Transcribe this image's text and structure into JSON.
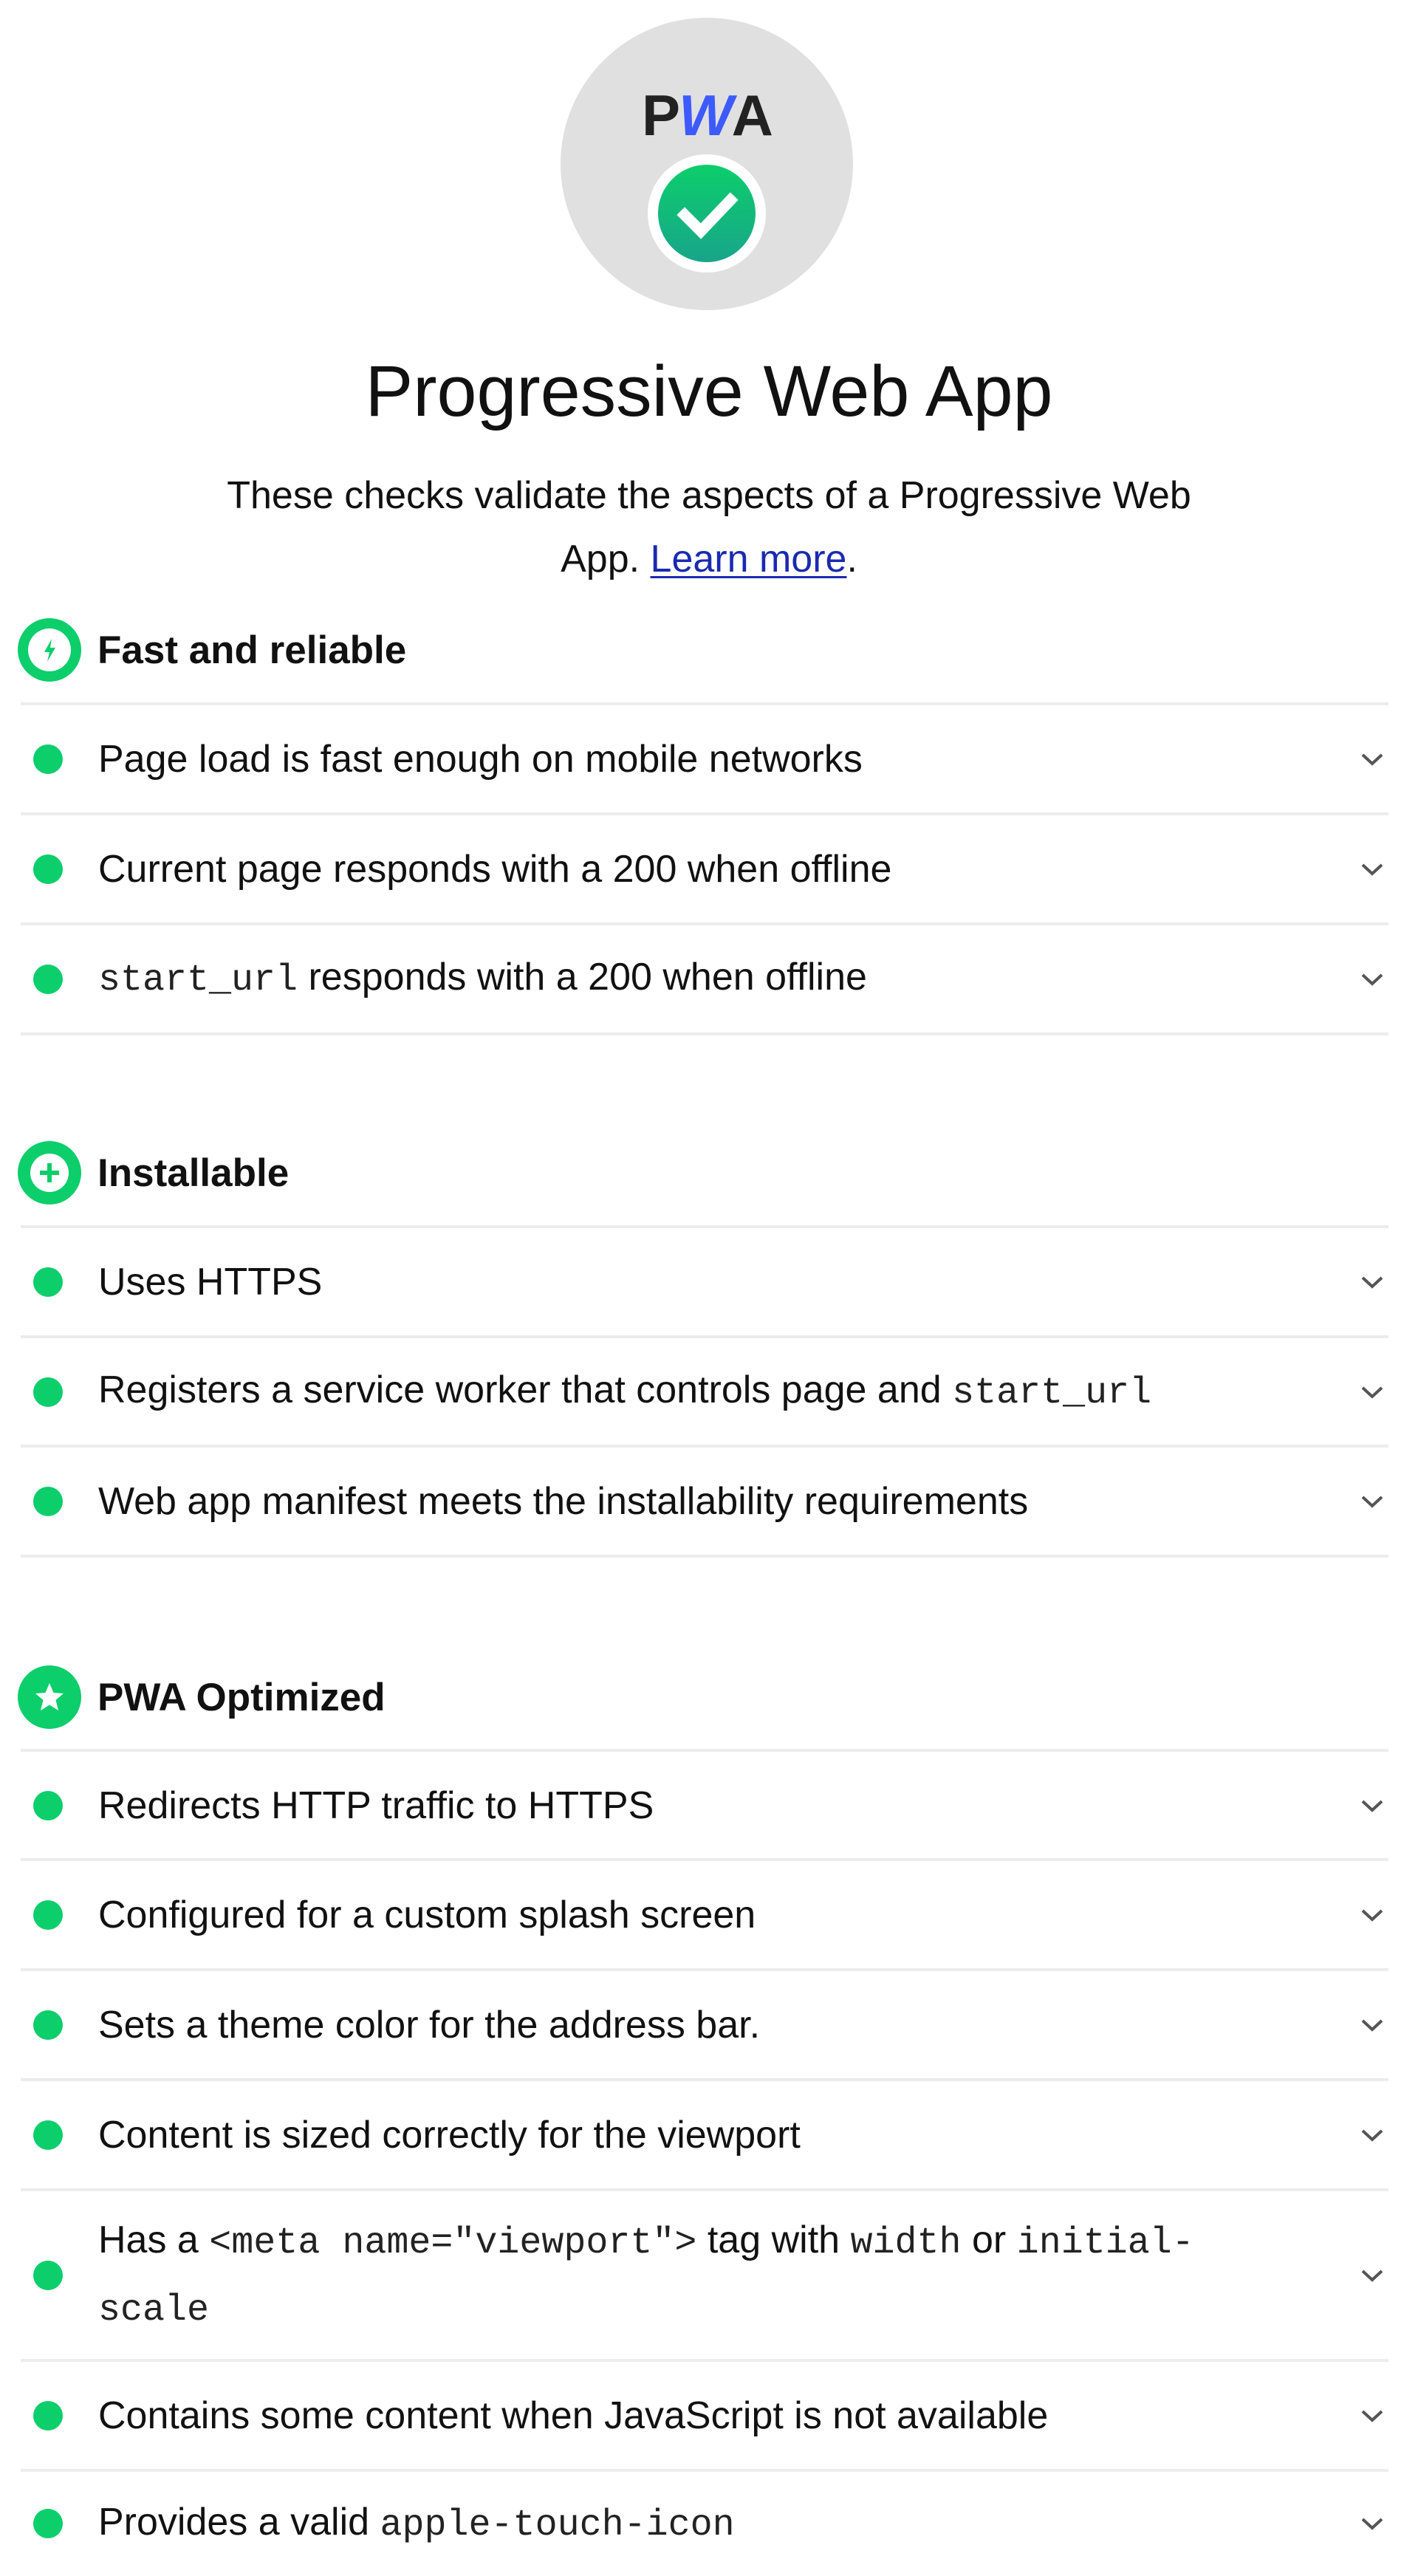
{
  "gauge": {
    "logo_parts": [
      "P",
      "W",
      "A"
    ],
    "status_icon": "check-icon",
    "colors": {
      "gauge_bg": "#e0e0e0",
      "pass_green": "#0cce6b",
      "logo_blue": "#3d5afe"
    }
  },
  "header": {
    "title": "Progressive Web App",
    "description": "These checks validate the aspects of a Progressive Web App.",
    "learn_more_label": "Learn more",
    "trailing_period": "."
  },
  "sections": [
    {
      "title": "Fast and reliable",
      "icon": "shield-lightning-icon",
      "audits": [
        {
          "parts": [
            {
              "t": "Page load is fast enough on mobile networks"
            }
          ]
        },
        {
          "parts": [
            {
              "t": "Current page responds with a 200 when offline"
            }
          ]
        },
        {
          "parts": [
            {
              "code": "start_url"
            },
            {
              "t": " responds with a 200 when offline"
            }
          ]
        }
      ]
    },
    {
      "title": "Installable",
      "icon": "plus-circle-icon",
      "audits": [
        {
          "parts": [
            {
              "t": "Uses HTTPS"
            }
          ]
        },
        {
          "parts": [
            {
              "t": "Registers a service worker that controls page and "
            },
            {
              "code": "start_url"
            }
          ]
        },
        {
          "parts": [
            {
              "t": "Web app manifest meets the installability requirements"
            }
          ]
        }
      ]
    },
    {
      "title": "PWA Optimized",
      "icon": "star-icon",
      "audits": [
        {
          "parts": [
            {
              "t": "Redirects HTTP traffic to HTTPS"
            }
          ]
        },
        {
          "parts": [
            {
              "t": "Configured for a custom splash screen"
            }
          ]
        },
        {
          "parts": [
            {
              "t": "Sets a theme color for the address bar."
            }
          ]
        },
        {
          "parts": [
            {
              "t": "Content is sized correctly for the viewport"
            }
          ]
        },
        {
          "parts": [
            {
              "t": "Has a "
            },
            {
              "code": "<meta name=\"viewport\">"
            },
            {
              "t": " tag with "
            },
            {
              "code": "width"
            },
            {
              "t": " or "
            },
            {
              "code": "initial-scale"
            }
          ]
        },
        {
          "parts": [
            {
              "t": "Contains some content when JavaScript is not available"
            }
          ]
        },
        {
          "parts": [
            {
              "t": "Provides a valid "
            },
            {
              "code": "apple-touch-icon"
            }
          ]
        }
      ]
    }
  ],
  "audit_status": "pass",
  "expand_icon": "chevron-down-icon"
}
